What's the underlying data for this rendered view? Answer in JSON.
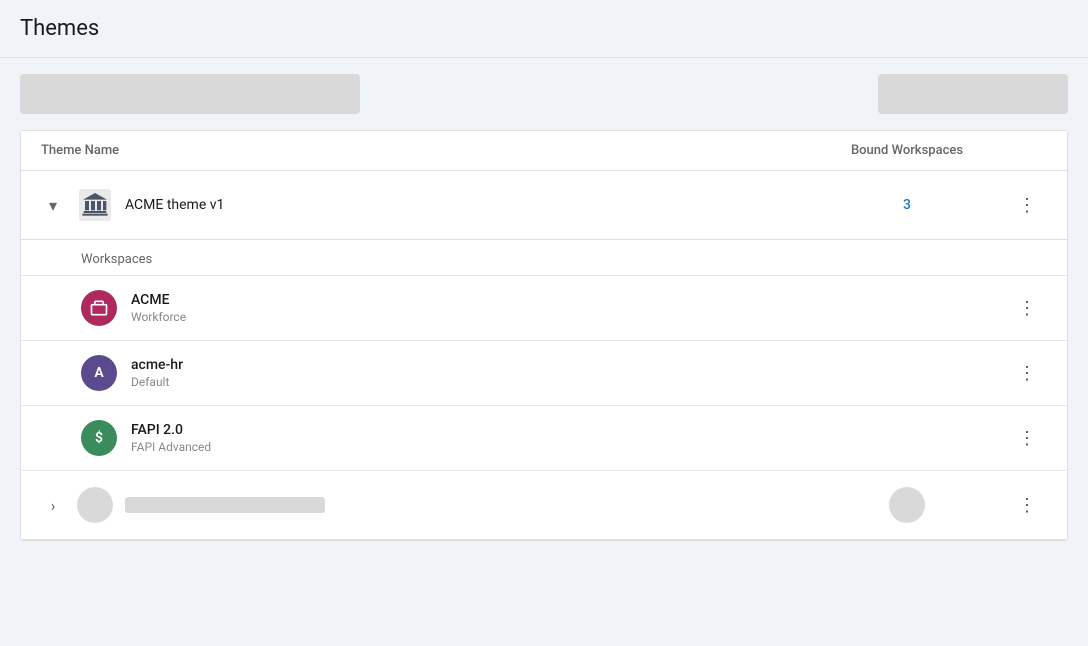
{
  "header": {
    "title": "Themes"
  },
  "toolbar": {
    "search_placeholder": "",
    "create_button_label": ""
  },
  "table": {
    "col_theme_name": "Theme Name",
    "col_bound_workspaces": "Bound Workspaces"
  },
  "themes": [
    {
      "id": "acme-theme-v1",
      "name": "ACME theme v1",
      "bound_count": "3",
      "expanded": true,
      "workspaces_label": "Workspaces",
      "workspaces": [
        {
          "id": "acme",
          "name": "ACME",
          "type": "Workforce",
          "avatar_text": "",
          "avatar_color": "#b0295e",
          "icon_type": "briefcase"
        },
        {
          "id": "acme-hr",
          "name": "acme-hr",
          "type": "Default",
          "avatar_text": "A",
          "avatar_color": "#5c4a8f",
          "icon_type": "letter"
        },
        {
          "id": "fapi-20",
          "name": "FAPI 2.0",
          "type": "FAPI Advanced",
          "avatar_text": "$",
          "avatar_color": "#3a8c5c",
          "icon_type": "dollar"
        }
      ]
    }
  ],
  "collapsed_theme": {
    "placeholder_bound": ""
  },
  "icons": {
    "chevron_down": "▾",
    "chevron_right": "›",
    "more_vert": "⋮"
  }
}
